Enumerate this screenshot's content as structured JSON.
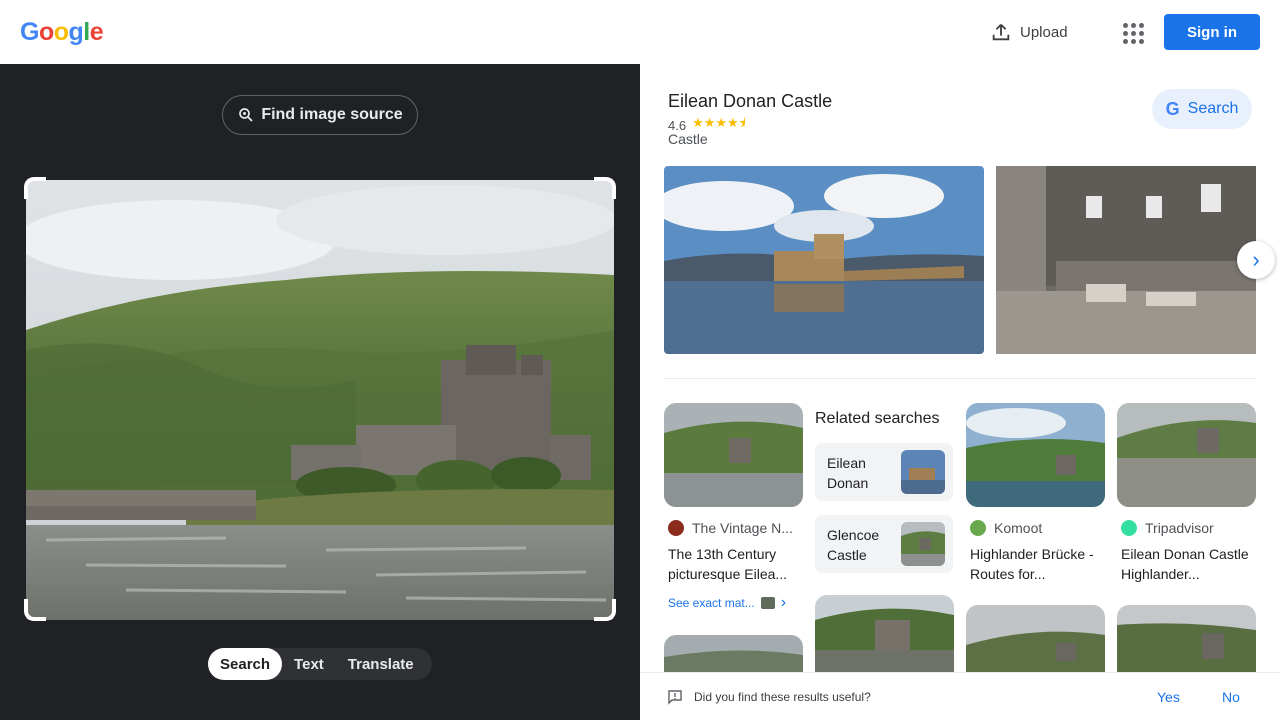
{
  "header": {
    "logo_letters": [
      {
        "ch": "G",
        "color": "#4285F4"
      },
      {
        "ch": "o",
        "color": "#EA4335"
      },
      {
        "ch": "o",
        "color": "#FBBC05"
      },
      {
        "ch": "g",
        "color": "#4285F4"
      },
      {
        "ch": "l",
        "color": "#34A853"
      },
      {
        "ch": "e",
        "color": "#EA4335"
      }
    ],
    "upload_label": "Upload",
    "apps_icon": "apps-grid-icon",
    "signin_label": "Sign in"
  },
  "lens": {
    "find_source_label": "Find image source",
    "modes": [
      {
        "label": "Search",
        "active": true
      },
      {
        "label": "Text",
        "active": false
      },
      {
        "label": "Translate",
        "active": false
      }
    ]
  },
  "knowledge_panel": {
    "title": "Eilean Donan Castle",
    "rating": "4.6",
    "rating_stars": 4.6,
    "type": "Castle",
    "search_label": "Search"
  },
  "results": {
    "related_heading": "Related searches",
    "related": [
      {
        "label": "Eilean Donan"
      },
      {
        "label": "Glencoe Castle"
      }
    ],
    "cards": [
      {
        "source": "The Vintage N...",
        "title": "The 13th Century picturesque Eilea...",
        "icon_color": "#8b2b1e"
      },
      {
        "source": "Komoot",
        "title": "Highlander Brücke - Routes for...",
        "icon_color": "#6aa84f"
      },
      {
        "source": "Tripadvisor",
        "title": "Eilean Donan Castle Highlander...",
        "icon_color": "#34e0a1"
      }
    ],
    "see_exact_label": "See exact mat..."
  },
  "feedback": {
    "question": "Did you find these results useful?",
    "yes": "Yes",
    "no": "No"
  }
}
